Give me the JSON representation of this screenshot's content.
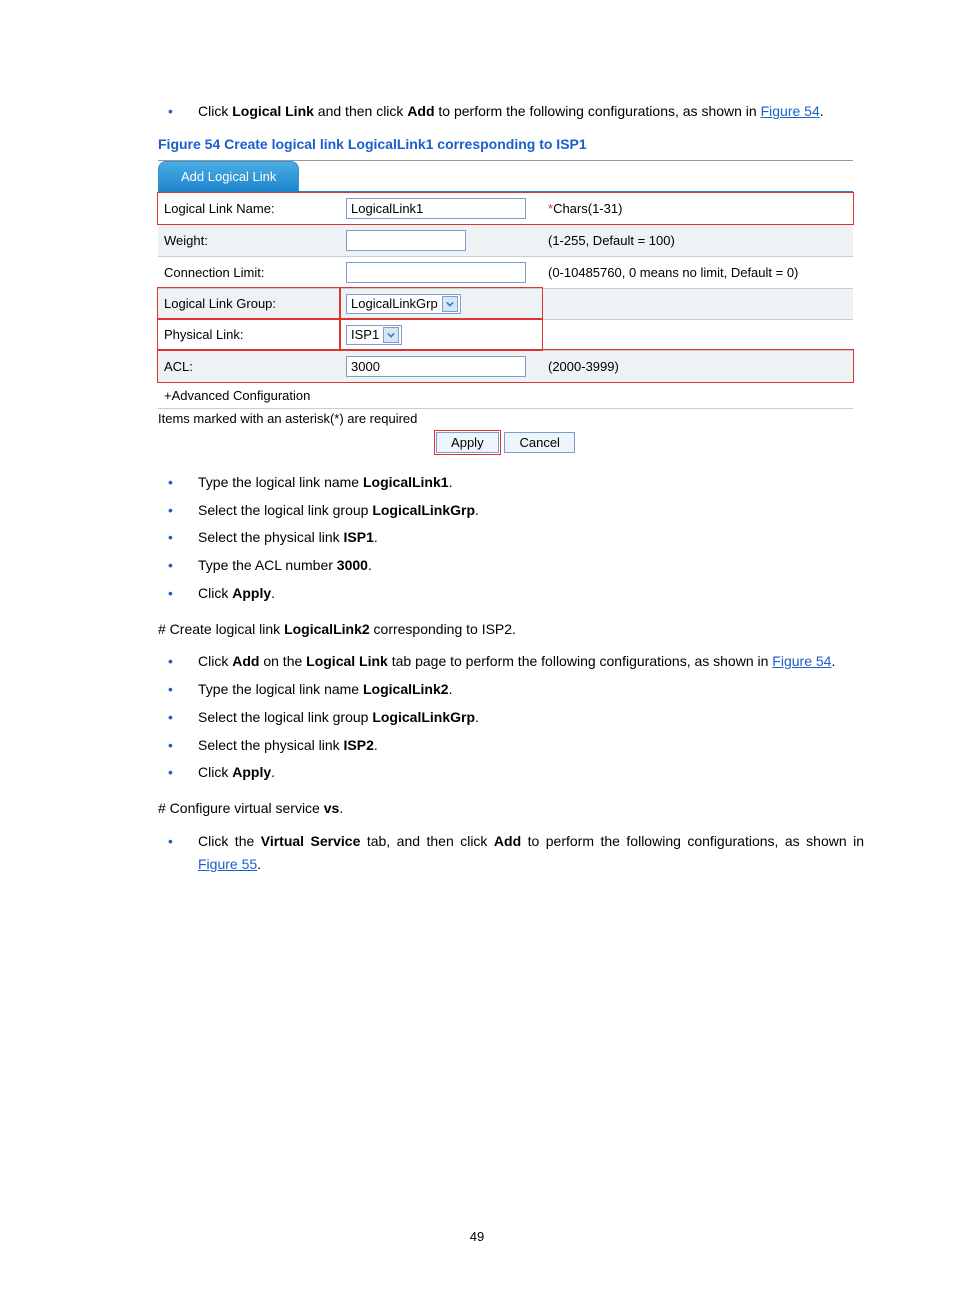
{
  "intro": {
    "click_text_1": "Click ",
    "logical_link": "Logical Link",
    "and_then_click": " and then click ",
    "add": "Add",
    "to_perform": " to perform the following configurations, as shown in ",
    "fig54_link": "Figure 54",
    "period": "."
  },
  "fig_caption": {
    "prefix": "Figure 54 Create logical link ",
    "name": "LogicalLink1",
    "suffix": " corresponding to ISP1"
  },
  "screenshot": {
    "tab": "Add Logical Link",
    "rows": {
      "name_label": "Logical Link Name:",
      "name_value": "LogicalLink1",
      "name_hint": "Chars(1-31)",
      "weight_label": "Weight:",
      "weight_hint": "(1-255, Default = 100)",
      "conn_label": "Connection Limit:",
      "conn_hint": "(0-10485760, 0 means no limit, Default = 0)",
      "group_label": "Logical Link Group:",
      "group_value": "LogicalLinkGrp",
      "phy_label": "Physical Link:",
      "phy_value": "ISP1",
      "acl_label": "ACL:",
      "acl_value": "3000",
      "acl_hint": "(2000-3999)"
    },
    "advanced": "+Advanced Configuration",
    "required_note": "Items marked with an asterisk(*) are required",
    "apply_btn": "Apply",
    "cancel_btn": "Cancel"
  },
  "steps1": {
    "s1a": "Type the logical link name ",
    "s1b": "LogicalLink1",
    "s1c": ".",
    "s2a": "Select the logical link group ",
    "s2b": "LogicalLinkGrp",
    "s2c": ".",
    "s3a": "Select the physical link ",
    "s3b": "ISP1",
    "s3c": ".",
    "s4a": "Type the ACL number ",
    "s4b": "3000",
    "s4c": ".",
    "s5a": "Click ",
    "s5b": "Apply",
    "s5c": "."
  },
  "hash1": {
    "a": "# Create logical link ",
    "b": "LogicalLink2",
    "c": " corresponding to ISP2."
  },
  "steps2": {
    "s1a": "Click ",
    "s1b": "Add",
    "s1c": " on the ",
    "s1d": "Logical Link",
    "s1e": " tab page to perform the following configurations, as shown in ",
    "s1f": "Figure 54",
    "s1g": ".",
    "s2a": "Type the logical link name ",
    "s2b": "LogicalLink2",
    "s2c": ".",
    "s3a": "Select the logical link group ",
    "s3b": "LogicalLinkGrp",
    "s3c": ".",
    "s4a": "Select the physical link ",
    "s4b": "ISP2",
    "s4c": ".",
    "s5a": "Click ",
    "s5b": "Apply",
    "s5c": "."
  },
  "hash2": {
    "a": "# Configure virtual service ",
    "b": "vs",
    "c": "."
  },
  "steps3": {
    "s1a": "Click the ",
    "s1b": "Virtual Service",
    "s1c": " tab, and then click ",
    "s1d": "Add",
    "s1e": " to perform the following configurations, as shown in ",
    "s1f": "Figure 55",
    "s1g": "."
  },
  "page_number": "49"
}
